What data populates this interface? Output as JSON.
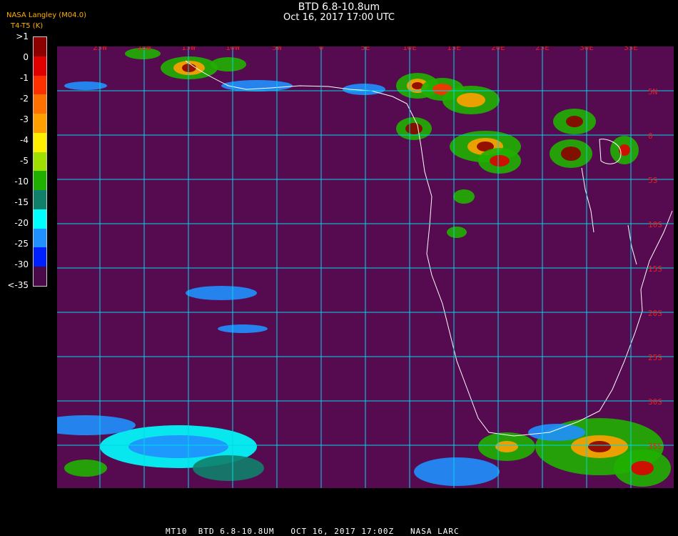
{
  "header": {
    "title": "BTD 6.8-10.8um",
    "datetime": "Oct 16, 2017 17:00 UTC",
    "org": "NASA Langley (M04.0)",
    "unit": "T4-T5 (K)"
  },
  "legend": {
    "labels": [
      ">1",
      "0",
      "-1",
      "-2",
      "-3",
      "-4",
      "-5",
      "-10",
      "-15",
      "-20",
      "-25",
      "-30",
      "<-35"
    ],
    "colors": [
      "#8c0000",
      "#e00000",
      "#ff3000",
      "#ff7000",
      "#ffa000",
      "#ffee00",
      "#a0e000",
      "#20b000",
      "#10806a",
      "#00ffff",
      "#2090ff",
      "#0020ff",
      "#4a0a4a"
    ]
  },
  "map": {
    "background": "#560a50",
    "grid_color": "#00d8e8",
    "label_color": "#e82020",
    "lon_labels": [
      "25W",
      "20W",
      "15W",
      "10W",
      "5W",
      "0",
      "5E",
      "10E",
      "15E",
      "20E",
      "25E",
      "30E",
      "35E"
    ],
    "lat_labels": [
      "5N",
      "0",
      "5S",
      "10S",
      "15S",
      "20S",
      "25S",
      "30S",
      "35S"
    ]
  },
  "footer": {
    "text": "MT10  BTD 6.8-10.8UM   OCT 16, 2017 17:00Z   NASA LARC"
  }
}
